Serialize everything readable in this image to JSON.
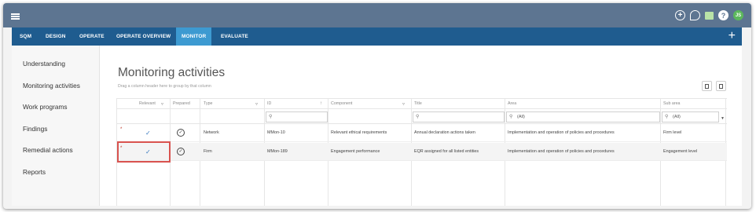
{
  "topbar": {
    "icons": [
      "add-circle-icon",
      "chat-icon",
      "notes-icon",
      "help-icon",
      "user-avatar-icon"
    ],
    "user_initials": "JS",
    "help_label": "?",
    "add_label": "+"
  },
  "nav": {
    "items": [
      {
        "label": "SQM",
        "active": false
      },
      {
        "label": "DESIGN",
        "active": false
      },
      {
        "label": "OPERATE",
        "active": false
      },
      {
        "label": "OPERATE OVERVIEW",
        "active": false
      },
      {
        "label": "MONITOR",
        "active": true
      },
      {
        "label": "EVALUATE",
        "active": false
      }
    ],
    "plus": "+"
  },
  "sidebar": {
    "items": [
      {
        "label": "Understanding"
      },
      {
        "label": "Monitoring activities"
      },
      {
        "label": "Work programs"
      },
      {
        "label": "Findings"
      },
      {
        "label": "Remedial actions"
      },
      {
        "label": "Reports"
      }
    ]
  },
  "main": {
    "title": "Monitoring activities",
    "group_hint": "Drag a column header here to group by that column"
  },
  "grid": {
    "columns": [
      "Relevant",
      "Prepared",
      "Type",
      "ID",
      "Component",
      "Title",
      "Area",
      "Sub area"
    ],
    "filters": {
      "area_value": "(All)",
      "subarea_value": "(All)"
    },
    "rows": [
      {
        "marker": "*",
        "relevant": "✓",
        "prepared": "✓",
        "type": "Network",
        "id": "MMon-10",
        "component": "Relevant ethical requirements",
        "title": "Annual declaration actions taken",
        "area": "Implementation and operation of policies and procedures",
        "subarea": "Firm level"
      },
      {
        "marker": "*",
        "relevant": "✓",
        "prepared": "✓",
        "type": "Firm",
        "id": "MMon-189",
        "component": "Engagement performance",
        "title": "EQR assigned for all listed entities",
        "area": "Implementation and operation of policies and procedures",
        "subarea": "Engagement level"
      }
    ]
  },
  "colors": {
    "topbar": "#5d7591",
    "navbar": "#1f5c8f",
    "nav_active": "#3d9ad1",
    "highlight": "#d9534f"
  }
}
